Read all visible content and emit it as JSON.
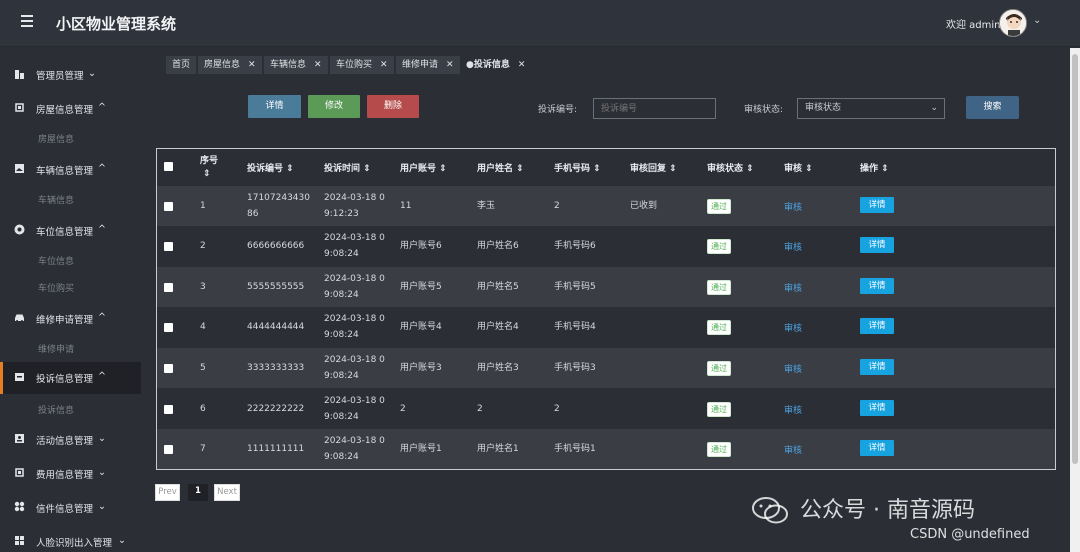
{
  "header": {
    "title": "小区物业管理系统",
    "welcome": "欢迎 admin"
  },
  "sidebar": {
    "groups": [
      {
        "label": "管理员管理",
        "icon": "building-icon"
      },
      {
        "label": "房屋信息管理",
        "icon": "chip-icon",
        "sub": [
          "房屋信息"
        ]
      },
      {
        "label": "车辆信息管理",
        "icon": "image-icon",
        "sub": [
          "车辆信息"
        ]
      },
      {
        "label": "车位信息管理",
        "icon": "record-icon",
        "sub": [
          "车位信息",
          "车位购买"
        ]
      },
      {
        "label": "维修申请管理",
        "icon": "car-icon",
        "sub": [
          "维修申请"
        ]
      },
      {
        "label": "投诉信息管理",
        "icon": "inbox-icon",
        "sub": [
          "投诉信息"
        ]
      },
      {
        "label": "活动信息管理",
        "icon": "badge-icon"
      },
      {
        "label": "费用信息管理",
        "icon": "chip-icon"
      },
      {
        "label": "信件信息管理",
        "icon": "grid-icon"
      },
      {
        "label": "人脸识别出入管理",
        "icon": "grid-icon"
      }
    ]
  },
  "tabs": [
    "首页",
    "房屋信息",
    "车辆信息",
    "车位购买",
    "维修申请",
    "●投诉信息"
  ],
  "toolbar": {
    "detail": "详情",
    "edit": "修改",
    "delete": "删除",
    "search": "搜索"
  },
  "filters": {
    "complaint_no_label": "投诉编号:",
    "complaint_no_placeholder": "投诉编号",
    "audit_status_label": "审核状态:",
    "audit_status_value": "审核状态"
  },
  "table": {
    "headers": [
      "序号",
      "投诉编号",
      "投诉时间",
      "用户账号",
      "用户姓名",
      "手机号码",
      "审核回复",
      "审核状态",
      "审核",
      "操作"
    ],
    "rows": [
      {
        "idx": "1",
        "no1": "17107243430",
        "no2": "86",
        "t1": "2024-03-18 0",
        "t2": "9:12:23",
        "account": "11",
        "name": "李玉",
        "phone": "2",
        "reply": "已收到",
        "status": "通过",
        "audit": "审核",
        "op": "详情"
      },
      {
        "idx": "2",
        "no1": "6666666666",
        "no2": "",
        "t1": "2024-03-18 0",
        "t2": "9:08:24",
        "account": "用户账号6",
        "name": "用户姓名6",
        "phone": "手机号码6",
        "reply": "",
        "status": "通过",
        "audit": "审核",
        "op": "详情"
      },
      {
        "idx": "3",
        "no1": "5555555555",
        "no2": "",
        "t1": "2024-03-18 0",
        "t2": "9:08:24",
        "account": "用户账号5",
        "name": "用户姓名5",
        "phone": "手机号码5",
        "reply": "",
        "status": "通过",
        "audit": "审核",
        "op": "详情"
      },
      {
        "idx": "4",
        "no1": "4444444444",
        "no2": "",
        "t1": "2024-03-18 0",
        "t2": "9:08:24",
        "account": "用户账号4",
        "name": "用户姓名4",
        "phone": "手机号码4",
        "reply": "",
        "status": "通过",
        "audit": "审核",
        "op": "详情"
      },
      {
        "idx": "5",
        "no1": "3333333333",
        "no2": "",
        "t1": "2024-03-18 0",
        "t2": "9:08:24",
        "account": "用户账号3",
        "name": "用户姓名3",
        "phone": "手机号码3",
        "reply": "",
        "status": "通过",
        "audit": "审核",
        "op": "详情"
      },
      {
        "idx": "6",
        "no1": "2222222222",
        "no2": "",
        "t1": "2024-03-18 0",
        "t2": "9:08:24",
        "account": "2",
        "name": "2",
        "phone": "2",
        "reply": "",
        "status": "通过",
        "audit": "审核",
        "op": "详情"
      },
      {
        "idx": "7",
        "no1": "1111111111",
        "no2": "",
        "t1": "2024-03-18 0",
        "t2": "9:08:24",
        "account": "用户账号1",
        "name": "用户姓名1",
        "phone": "手机号码1",
        "reply": "",
        "status": "通过",
        "audit": "审核",
        "op": "详情"
      }
    ]
  },
  "pagination": {
    "prev": "Prev",
    "current": "1",
    "next": "Next"
  },
  "watermark": {
    "line1": "公众号 · 南音源码",
    "line2": "CSDN @undefined"
  }
}
